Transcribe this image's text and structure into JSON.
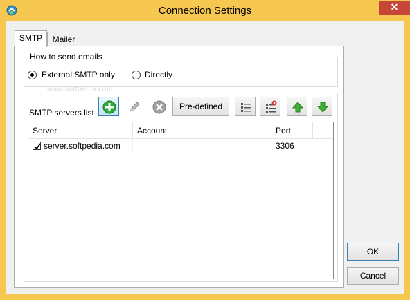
{
  "window": {
    "title": "Connection Settings",
    "close_glyph": "✕",
    "app_icon": "plug-icon"
  },
  "tabs": [
    {
      "label": "SMTP",
      "active": true
    },
    {
      "label": "Mailer",
      "active": false
    }
  ],
  "how_to_send": {
    "group_label": "How to send emails",
    "options": [
      {
        "label": "External SMTP only",
        "checked": true
      },
      {
        "label": "Directly",
        "checked": false
      }
    ]
  },
  "watermark": "www.softpedia.com",
  "servers": {
    "label": "SMTP servers list",
    "toolbar": {
      "add_icon": "add-icon",
      "edit_icon": "pencil-icon",
      "remove_icon": "remove-icon",
      "predefined_label": "Pre-defined",
      "list_icon": "list-icon",
      "clear_list_icon": "list-remove-icon",
      "move_up_icon": "arrow-up-icon",
      "move_down_icon": "arrow-down-icon"
    },
    "columns": [
      "Server",
      "Account",
      "Port"
    ],
    "rows": [
      {
        "checked": true,
        "server": "server.softpedia.com",
        "account": "",
        "port": "3306"
      }
    ]
  },
  "buttons": {
    "ok": "OK",
    "cancel": "Cancel"
  },
  "colors": {
    "title_bar": "#f7c850",
    "close_button": "#c7463a",
    "add_green": "#2eaa36",
    "arrow_green": "#3cb034"
  }
}
